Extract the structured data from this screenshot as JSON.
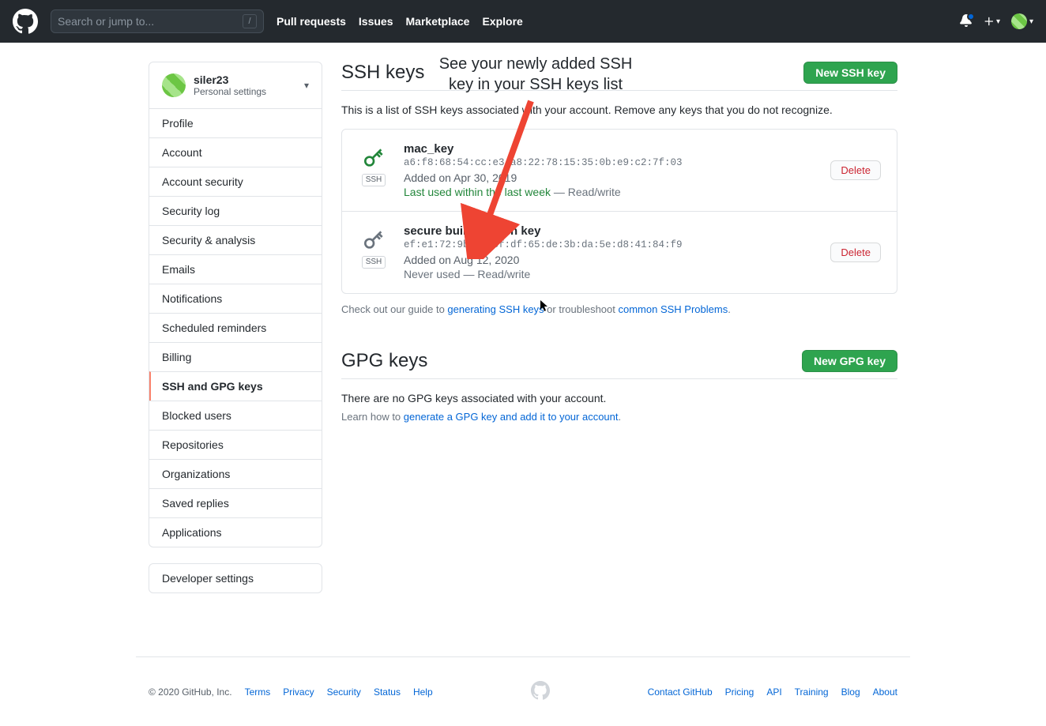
{
  "header": {
    "search_placeholder": "Search or jump to...",
    "nav": [
      "Pull requests",
      "Issues",
      "Marketplace",
      "Explore"
    ]
  },
  "sidebar": {
    "username": "siler23",
    "subtitle": "Personal settings",
    "items": [
      {
        "label": "Profile"
      },
      {
        "label": "Account"
      },
      {
        "label": "Account security"
      },
      {
        "label": "Security log"
      },
      {
        "label": "Security & analysis"
      },
      {
        "label": "Emails"
      },
      {
        "label": "Notifications"
      },
      {
        "label": "Scheduled reminders"
      },
      {
        "label": "Billing"
      },
      {
        "label": "SSH and GPG keys",
        "selected": true
      },
      {
        "label": "Blocked users"
      },
      {
        "label": "Repositories"
      },
      {
        "label": "Organizations"
      },
      {
        "label": "Saved replies"
      },
      {
        "label": "Applications"
      }
    ],
    "dev_settings": "Developer settings"
  },
  "annotation": "See your newly added SSH key in your SSH keys list",
  "ssh": {
    "heading": "SSH keys",
    "new_btn": "New SSH key",
    "description": "This is a list of SSH keys associated with your account. Remove any keys that you do not recognize.",
    "keys": [
      {
        "name": "mac_key",
        "fingerprint": "a6:f8:68:54:cc:e3:a8:22:78:15:35:0b:e9:c2:7f:03",
        "added": "Added on Apr 30, 2019",
        "last_used": "Last used within the last week",
        "access": "— Read/write",
        "badge": "SSH",
        "recent": true,
        "delete": "Delete"
      },
      {
        "name": "secure build lab ssh key",
        "fingerprint": "ef:e1:72:9b:e8:5f:df:65:de:3b:da:5e:d8:41:84:f9",
        "added": "Added on Aug 12, 2020",
        "last_used": "Never used",
        "access": "— Read/write",
        "badge": "SSH",
        "recent": false,
        "delete": "Delete"
      }
    ],
    "guide_pre": "Check out our guide to ",
    "guide_link1": "generating SSH keys",
    "guide_mid": " or troubleshoot ",
    "guide_link2": "common SSH Problems",
    "guide_post": "."
  },
  "gpg": {
    "heading": "GPG keys",
    "new_btn": "New GPG key",
    "none": "There are no GPG keys associated with your account.",
    "learn_pre": "Learn how to ",
    "learn_link": "generate a GPG key and add it to your account",
    "learn_post": "."
  },
  "footer": {
    "copyright": "© 2020 GitHub, Inc.",
    "left": [
      "Terms",
      "Privacy",
      "Security",
      "Status",
      "Help"
    ],
    "right": [
      "Contact GitHub",
      "Pricing",
      "API",
      "Training",
      "Blog",
      "About"
    ]
  }
}
